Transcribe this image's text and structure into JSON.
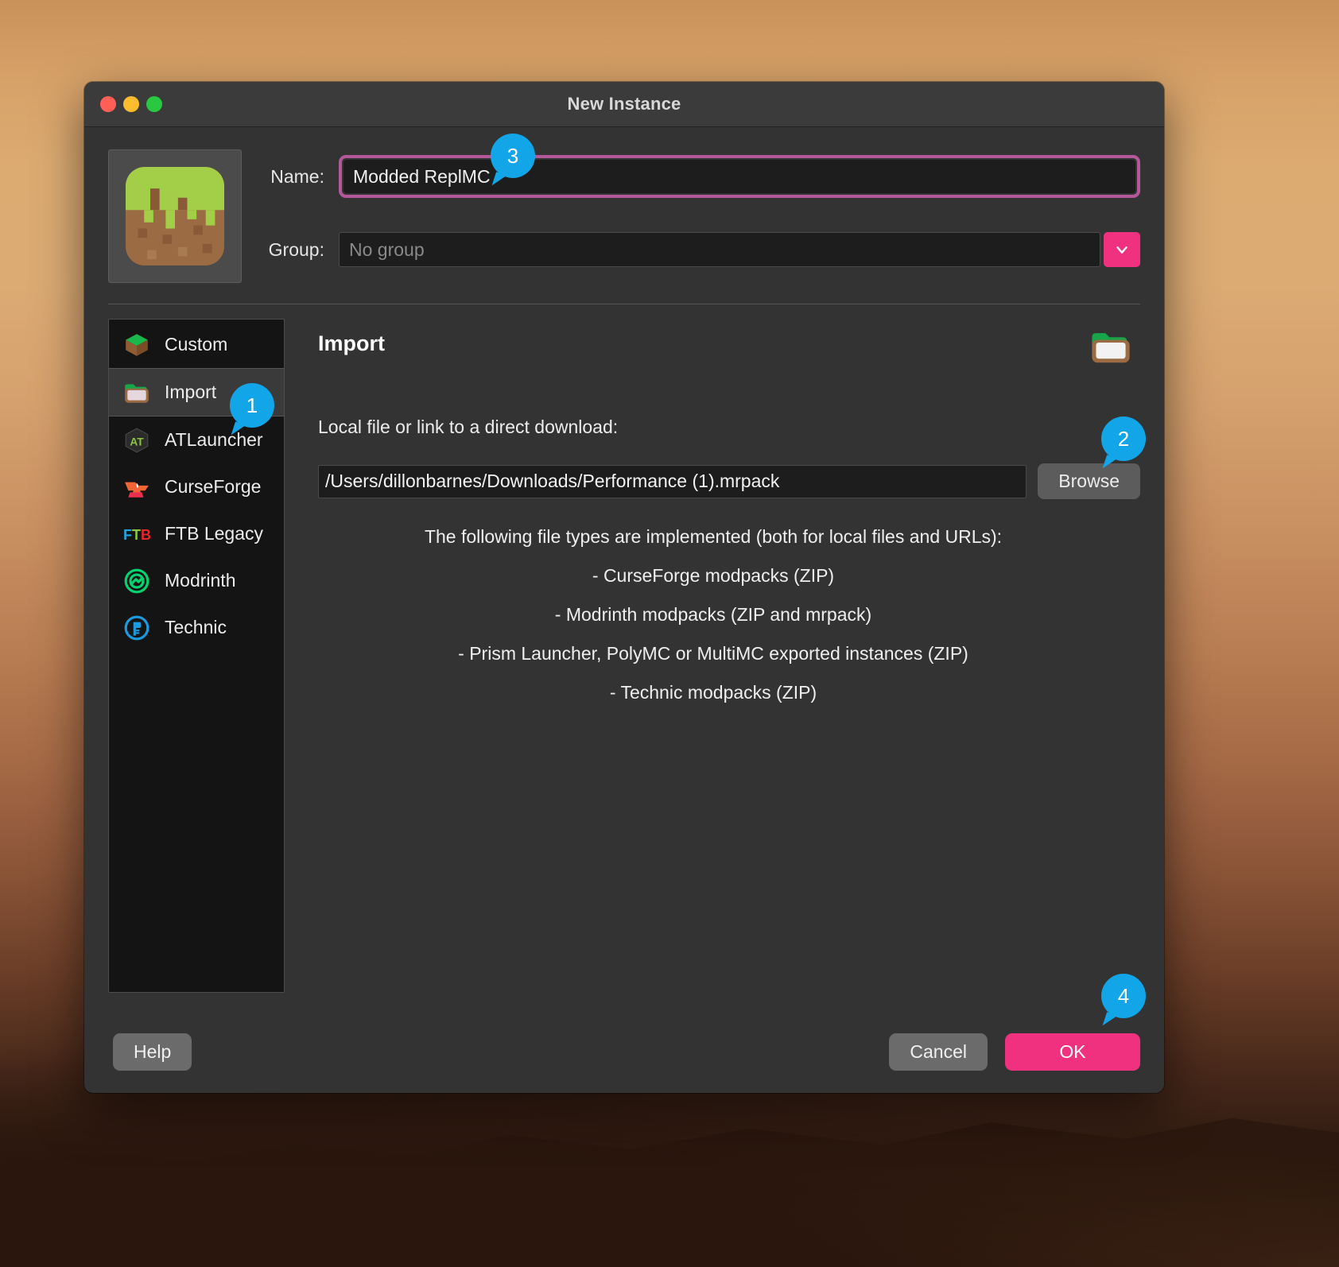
{
  "window": {
    "title": "New Instance",
    "traffic_lights": [
      "close",
      "minimize",
      "maximize"
    ]
  },
  "form": {
    "name_label": "Name:",
    "name_value": "Modded ReplMC",
    "group_label": "Group:",
    "group_placeholder": "No group",
    "group_value": "",
    "instance_icon": "grass-block-icon"
  },
  "sidebar": {
    "items": [
      {
        "label": "Custom",
        "icon": "grass-block-icon",
        "selected": false
      },
      {
        "label": "Import",
        "icon": "import-folder-icon",
        "selected": true
      },
      {
        "label": "ATLauncher",
        "icon": "atlauncher-icon",
        "selected": false
      },
      {
        "label": "CurseForge",
        "icon": "curseforge-anvil-icon",
        "selected": false
      },
      {
        "label": "FTB Legacy",
        "icon": "ftb-icon",
        "selected": false
      },
      {
        "label": "Modrinth",
        "icon": "modrinth-icon",
        "selected": false
      },
      {
        "label": "Technic",
        "icon": "technic-icon",
        "selected": false
      }
    ]
  },
  "panel": {
    "title": "Import",
    "header_icon": "import-folder-icon",
    "local_file_label": "Local file or link to a direct download:",
    "path_value": "/Users/dillonbarnes/Downloads/Performance (1).mrpack",
    "path_placeholder": "",
    "browse_label": "Browse",
    "filetypes_intro": "The following file types are implemented (both for local files and URLs):",
    "filetypes": [
      "- CurseForge modpacks (ZIP)",
      "- Modrinth modpacks (ZIP and mrpack)",
      "- Prism Launcher, PolyMC or MultiMC exported instances (ZIP)",
      "- Technic modpacks (ZIP)"
    ]
  },
  "footer": {
    "help_label": "Help",
    "cancel_label": "Cancel",
    "ok_label": "OK"
  },
  "callouts": [
    {
      "number": "1",
      "target": "sidebar-item-import"
    },
    {
      "number": "2",
      "target": "browse-button"
    },
    {
      "number": "3",
      "target": "name-input"
    },
    {
      "number": "4",
      "target": "ok-button"
    }
  ],
  "colors": {
    "accent_pink": "#f0317f",
    "highlight_outline": "#b5589b",
    "callout_blue": "#12a5e8",
    "window_bg": "#333333",
    "sidebar_bg": "#141414"
  }
}
